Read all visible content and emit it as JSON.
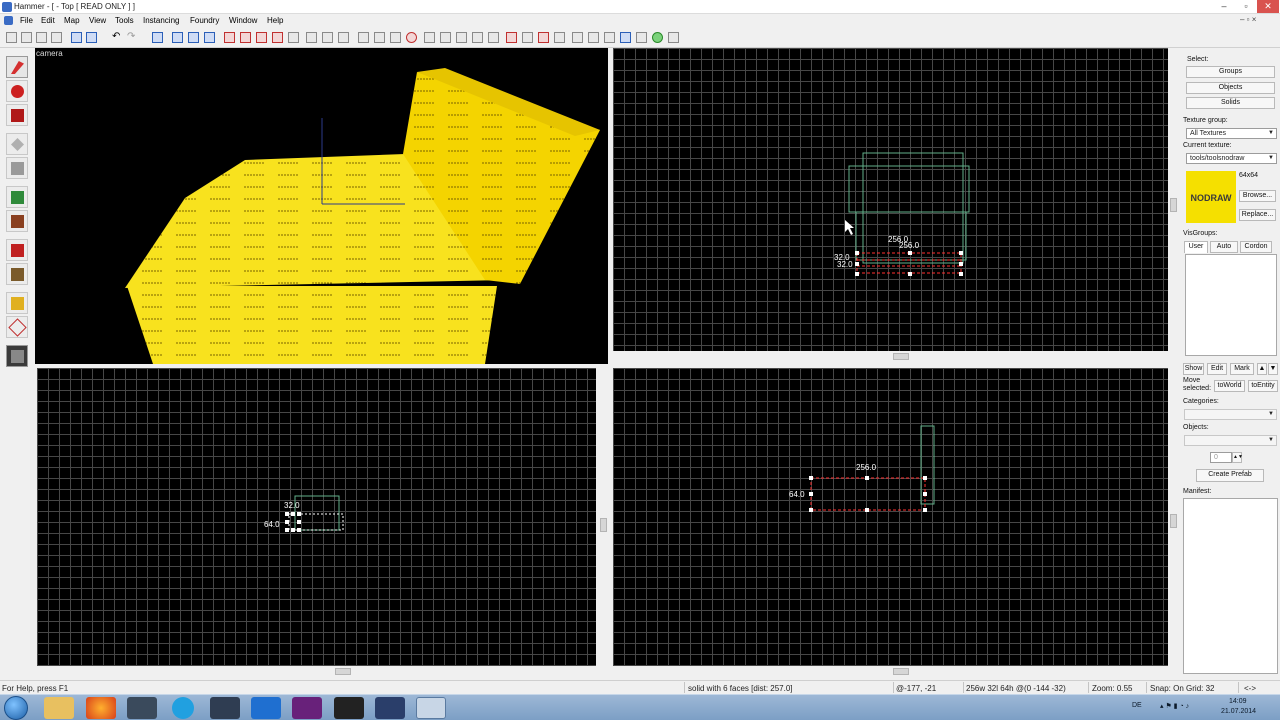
{
  "window": {
    "title": "Hammer - [ - Top [ READ ONLY ] ]",
    "minimize": "–",
    "restore": "▫",
    "close": "✕",
    "doc_controls": "– ▫ ×"
  },
  "menu": [
    "File",
    "Edit",
    "Map",
    "View",
    "Tools",
    "Instancing",
    "Foundry",
    "Window",
    "Help"
  ],
  "viewports": {
    "camera": {
      "label": "camera",
      "nodraw_text": "NODRAW"
    },
    "top": {
      "labels": [
        "256.0",
        "256.0",
        "32.0",
        "32.0"
      ]
    },
    "side": {
      "labels": [
        "32.0",
        "64.0"
      ]
    },
    "front": {
      "labels": [
        "256.0",
        "64.0"
      ]
    }
  },
  "panel": {
    "select_label": "Select:",
    "select_buttons": [
      "Groups",
      "Objects",
      "Solids"
    ],
    "texture_group_label": "Texture group:",
    "texture_group_value": "All Textures",
    "current_texture_label": "Current texture:",
    "current_texture_value": "tools/toolsnodraw",
    "texture_size": "64x64",
    "texture_name": "NODRAW",
    "browse": "Browse...",
    "replace": "Replace...",
    "visgroups_label": "VisGroups:",
    "visgroup_tabs": [
      "User",
      "Auto",
      "Cordon"
    ],
    "visgroup_actions": [
      "Show",
      "Edit",
      "Mark"
    ],
    "move_selected_label": "Move selected:",
    "to_world": "toWorld",
    "to_entity": "toEntity",
    "categories_label": "Categories:",
    "objects_label": "Objects:",
    "spin_value": "0",
    "create_prefab": "Create Prefab",
    "manifest_label": "Manifest:"
  },
  "status": {
    "help": "For Help, press F1",
    "selection": "solid with 6 faces  [dist: 257.0]",
    "coords": "@-177, -21",
    "size": "256w 32l 64h @(0 -144 -32)",
    "zoom": "Zoom: 0.55",
    "snap": "Snap: On Grid: 32",
    "arrows": "<->"
  },
  "tray": {
    "lang": "DE",
    "time": "14:09",
    "date": "21.07.2014"
  },
  "colors": {
    "viewport_bg": "#000000",
    "grid": "#474747",
    "nodraw_yellow": "#f4d400",
    "selection_red": "#ff3030",
    "bbox_green": "#62b08a"
  }
}
